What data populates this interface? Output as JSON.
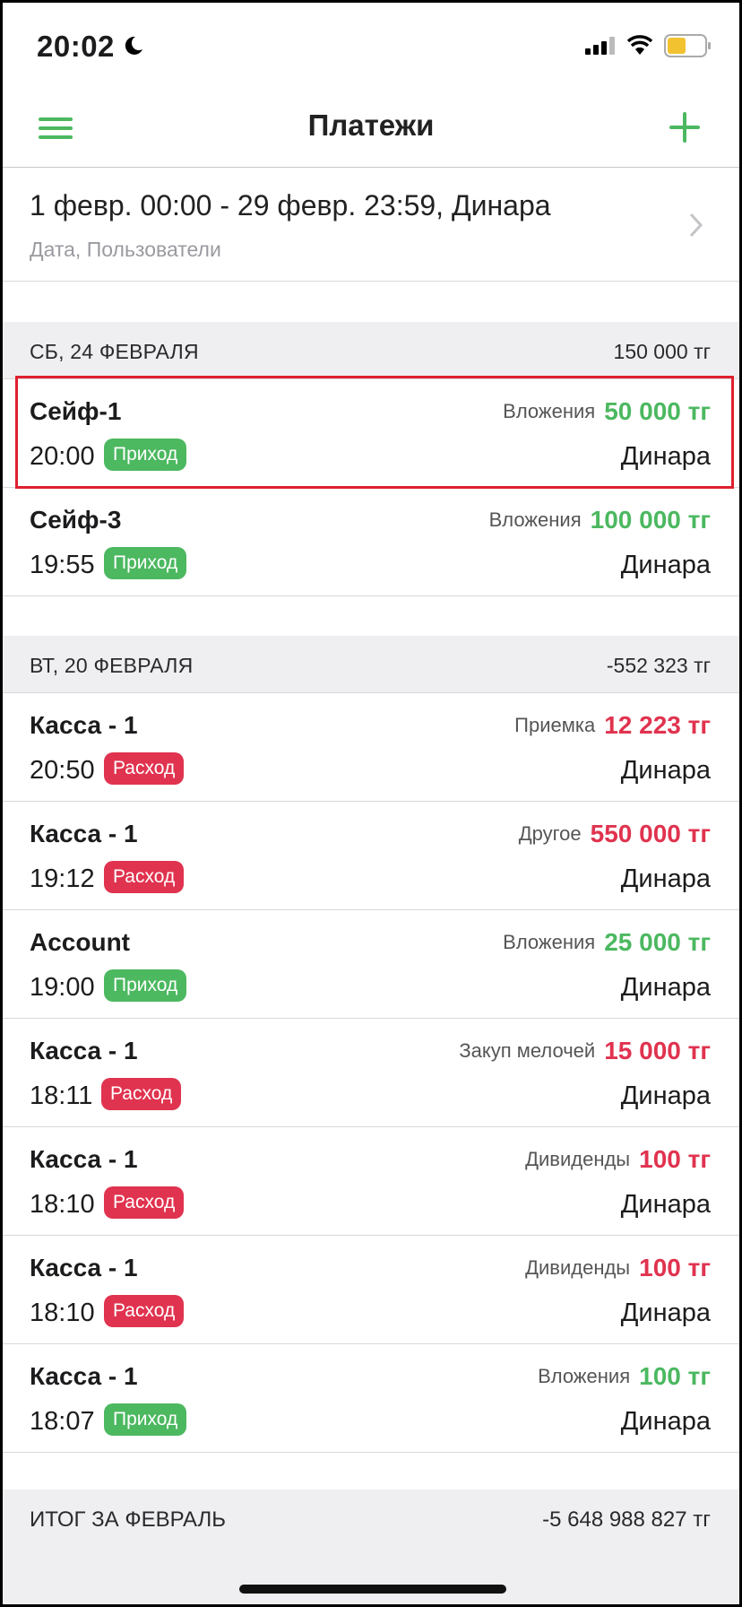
{
  "status_bar": {
    "time": "20:02"
  },
  "nav": {
    "title": "Платежи"
  },
  "filter": {
    "main": "1 февр. 00:00 - 29 февр. 23:59, Динара",
    "sub": "Дата, Пользователи"
  },
  "sections": [
    {
      "date": "СБ, 24 ФЕВРАЛЯ",
      "sum": "150 000 тг",
      "rows": [
        {
          "account": "Сейф-1",
          "time": "20:00",
          "type": "Приход",
          "category": "Вложения",
          "amount": "50 000 тг",
          "user": "Динара"
        },
        {
          "account": "Сейф-3",
          "time": "19:55",
          "type": "Приход",
          "category": "Вложения",
          "amount": "100 000 тг",
          "user": "Динара"
        }
      ]
    },
    {
      "date": "ВТ, 20 ФЕВРАЛЯ",
      "sum": "-552 323 тг",
      "rows": [
        {
          "account": "Касса - 1",
          "time": "20:50",
          "type": "Расход",
          "category": "Приемка",
          "amount": "12 223 тг",
          "user": "Динара"
        },
        {
          "account": "Касса - 1",
          "time": "19:12",
          "type": "Расход",
          "category": "Другое",
          "amount": "550 000 тг",
          "user": "Динара"
        },
        {
          "account": "Account",
          "time": "19:00",
          "type": "Приход",
          "category": "Вложения",
          "amount": "25 000 тг",
          "user": "Динара"
        },
        {
          "account": "Касса - 1",
          "time": "18:11",
          "type": "Расход",
          "category": "Закуп мелочей",
          "amount": "15 000 тг",
          "user": "Динара"
        },
        {
          "account": "Касса - 1",
          "time": "18:10",
          "type": "Расход",
          "category": "Дивиденды",
          "amount": "100 тг",
          "user": "Динара"
        },
        {
          "account": "Касса - 1",
          "time": "18:10",
          "type": "Расход",
          "category": "Дивиденды",
          "amount": "100 тг",
          "user": "Динара"
        },
        {
          "account": "Касса - 1",
          "time": "18:07",
          "type": "Приход",
          "category": "Вложения",
          "amount": "100 тг",
          "user": "Динара"
        }
      ]
    }
  ],
  "footer": {
    "label": "ИТОГ ЗА ФЕВРАЛЬ",
    "sum": "-5 648 988 827 тг"
  },
  "colors": {
    "accent": "#4cb860",
    "income": "#4cb860",
    "expense": "#e0334f",
    "highlight": "#e0202e"
  }
}
